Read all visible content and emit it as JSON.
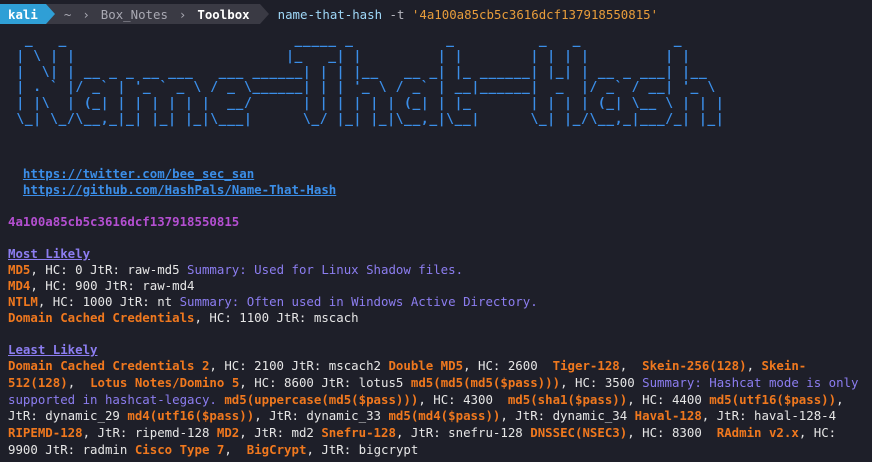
{
  "prompt": {
    "user": "kali",
    "path": [
      "~",
      "Box_Notes",
      "Toolbox"
    ],
    "command": "name-that-hash",
    "flag": "-t",
    "arg": "'4a100a85cb5c3616dcf137918550815'"
  },
  "banner": "  _   _                           _____ _           _          _   _           _     \n | \\ | |                         |_   _| |         | |        | | | |         | |    \n |  \\| | __ _ _ __ ___   ___ ______| | | |__   __ _| |_ ______| |_| | __ _ ___| |__  \n | . ` |/ _` | '_ ` _ \\ / _ \\______| | | '_ \\ / _` | __|______|  _  |/ _` / __| '_ \\ \n | |\\  | (_| | | | | | |  __/      | | | | | | (_| | |_       | | | | (_| \\__ \\ | | |\n \\_| \\_/\\__,_|_| |_| |_|\\___|      \\_/ |_| |_|\\__,_|\\__|      \\_| |_/\\__,_|___/_| |_|",
  "links": [
    "https://twitter.com/bee_sec_san",
    "https://github.com/HashPals/Name-That-Hash"
  ],
  "hash": "4a100a85cb5c3616dcf137918550815",
  "most_likely": {
    "heading": "Most Likely",
    "items": [
      {
        "name": "MD5",
        "detail": ", HC: 0 JtR: raw-md5 ",
        "summary": "Summary: Used for Linux Shadow files."
      },
      {
        "name": "MD4",
        "detail": ", HC: 900 JtR: raw-md4",
        "summary": ""
      },
      {
        "name": "NTLM",
        "detail": ", HC: 1000 JtR: nt ",
        "summary": "Summary: Often used in Windows Active Directory."
      },
      {
        "name": "Domain Cached Credentials",
        "detail": ", HC: 1100 JtR: mscach",
        "summary": ""
      }
    ]
  },
  "least_likely": {
    "heading": "Least Likely",
    "items": [
      {
        "name": "Domain Cached Credentials 2",
        "detail": ", HC: 2100 JtR: mscach2 ",
        "summary": ""
      },
      {
        "name": "Double MD5",
        "detail": ", HC: 2600  ",
        "summary": ""
      },
      {
        "name": "Tiger-128",
        "detail": ",  ",
        "summary": ""
      },
      {
        "name": "Skein-256(128)",
        "detail": ", ",
        "summary": ""
      },
      {
        "name": "Skein-512(128)",
        "detail": ",  ",
        "summary": ""
      },
      {
        "name": "Lotus Notes/Domino 5",
        "detail": ", HC: 8600 JtR: lotus5 ",
        "summary": ""
      },
      {
        "name": "md5(md5(md5($pass)))",
        "detail": ", HC: 3500 ",
        "summary": "Summary: Hashcat mode is only supported in hashcat-legacy. "
      },
      {
        "name": "md5(uppercase(md5($pass)))",
        "detail": ", HC: 4300  ",
        "summary": ""
      },
      {
        "name": "md5(sha1($pass))",
        "detail": ", HC: 4400 ",
        "summary": ""
      },
      {
        "name": "md5(utf16($pass))",
        "detail": ", JtR: dynamic_29 ",
        "summary": ""
      },
      {
        "name": "md4(utf16($pass))",
        "detail": ", JtR: dynamic_33 ",
        "summary": ""
      },
      {
        "name": "md5(md4($pass))",
        "detail": ", JtR: dynamic_34 ",
        "summary": ""
      },
      {
        "name": "Haval-128",
        "detail": ", JtR: haval-128-4 ",
        "summary": ""
      },
      {
        "name": "RIPEMD-128",
        "detail": ", JtR: ripemd-128 ",
        "summary": ""
      },
      {
        "name": "MD2",
        "detail": ", JtR: md2 ",
        "summary": ""
      },
      {
        "name": "Snefru-128",
        "detail": ", JtR: snefru-128 ",
        "summary": ""
      },
      {
        "name": "DNSSEC(NSEC3)",
        "detail": ", HC: 8300  ",
        "summary": ""
      },
      {
        "name": "RAdmin v2.x",
        "detail": ", HC: 9900 JtR: radmin ",
        "summary": ""
      },
      {
        "name": "Cisco Type 7",
        "detail": ",  ",
        "summary": ""
      },
      {
        "name": "BigCrypt",
        "detail": ", JtR: bigcrypt",
        "summary": ""
      }
    ]
  }
}
